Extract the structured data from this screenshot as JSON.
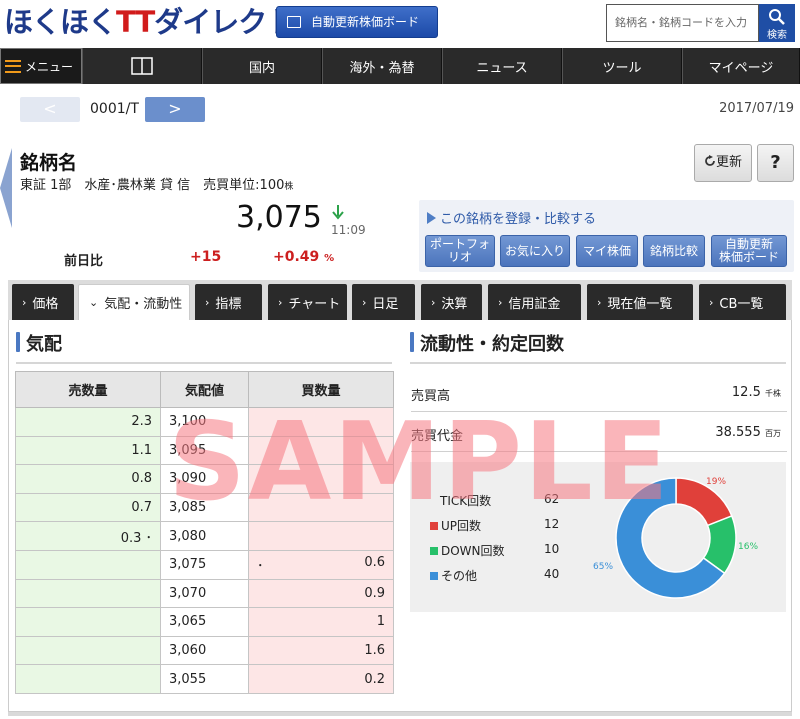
{
  "header": {
    "logo_blue": "ほくほく",
    "logo_red": "TT",
    "logo_blue2": "ダイレクト",
    "auto_board_label": "自動更新株価ボード",
    "search_placeholder": "銘柄名・銘柄コードを入力",
    "search_button_label": "検索"
  },
  "nav": {
    "menu_label": "メニュー",
    "items": [
      "国内",
      "海外・為替",
      "ニュース",
      "ツール",
      "マイページ"
    ]
  },
  "pager": {
    "prev_label": "<",
    "code": "0001/T",
    "next_label": ">",
    "date": "2017/07/19"
  },
  "stock": {
    "name": "銘柄名",
    "info": "東証 1部　水産･農林業 貸 信　売買単位:100",
    "info_unit": "株",
    "price": "3,075",
    "time": "11:09",
    "change_label": "前日比",
    "change_value": "+15",
    "change_pct": "+0.49",
    "change_pct_unit": "%"
  },
  "actions": {
    "refresh_label": "更新",
    "help_label": "?"
  },
  "register": {
    "title": "この銘柄を登録・比較する",
    "buttons": [
      "ポートフォリオ",
      "お気に入り",
      "マイ株価",
      "銘柄比較",
      "自動更新",
      "株価ボード"
    ]
  },
  "tabs": [
    "価格",
    "気配・流動性",
    "指標",
    "チャート",
    "日足",
    "決算",
    "信用証金",
    "現在値一覧",
    "CB一覧"
  ],
  "quote": {
    "title": "気配",
    "headers": [
      "売数量",
      "気配値",
      "買数量"
    ],
    "rows": [
      {
        "sell": "2.3",
        "price": "3,100",
        "buy": ""
      },
      {
        "sell": "1.1",
        "price": "3,095",
        "buy": ""
      },
      {
        "sell": "0.8",
        "price": "3,090",
        "buy": ""
      },
      {
        "sell": "0.7",
        "price": "3,085",
        "buy": ""
      },
      {
        "sell": "0.3 ･",
        "price": "3,080",
        "buy": ""
      },
      {
        "sell": "",
        "price": "3,075",
        "buy": "0.6"
      },
      {
        "sell": "",
        "price": "3,070",
        "buy": "0.9"
      },
      {
        "sell": "",
        "price": "3,065",
        "buy": "1"
      },
      {
        "sell": "",
        "price": "3,060",
        "buy": "1.6"
      },
      {
        "sell": "",
        "price": "3,055",
        "buy": "0.2"
      }
    ],
    "buy_marker": "･"
  },
  "liquidity": {
    "title": "流動性・約定回数",
    "volume_label": "売買高",
    "volume_value": "12.5",
    "volume_unit": "千株",
    "turnover_label": "売買代金",
    "turnover_value": "38.555",
    "turnover_unit": "百万",
    "ticks": [
      {
        "label": "TICK回数",
        "value": "62",
        "color": ""
      },
      {
        "label": "UP回数",
        "value": "12",
        "color": "#e0403a"
      },
      {
        "label": "DOWN回数",
        "value": "10",
        "color": "#27c06a"
      },
      {
        "label": "その他",
        "value": "40",
        "color": "#3a8fd8"
      }
    ]
  },
  "chart_data": {
    "type": "pie",
    "categories": [
      "UP回数",
      "DOWN回数",
      "その他"
    ],
    "values": [
      19,
      16,
      65
    ],
    "labels": [
      "19%",
      "16%",
      "65%"
    ],
    "colors": [
      "#e0403a",
      "#27c06a",
      "#3a8fd8"
    ]
  },
  "watermark": "SAMPLE"
}
